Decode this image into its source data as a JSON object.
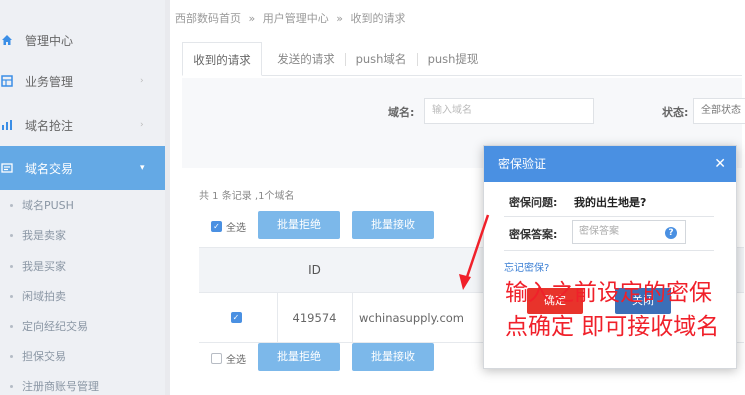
{
  "breadcrumb": [
    "西部数码首页",
    "»",
    "用户管理中心",
    "»",
    "收到的请求"
  ],
  "sidebar": {
    "items": [
      {
        "label": "管理中心",
        "icon": "home-icon",
        "arrow": ""
      },
      {
        "label": "业务管理",
        "icon": "grid-icon",
        "arrow": "›"
      },
      {
        "label": "域名抢注",
        "icon": "bar-chart-icon",
        "arrow": "›"
      },
      {
        "label": "域名交易",
        "icon": "trade-icon",
        "arrow": "▾"
      }
    ],
    "sub_items": [
      "域名PUSH",
      "我是卖家",
      "我是买家",
      "闲域拍卖",
      "定向经纪交易",
      "担保交易",
      "注册商账号管理"
    ]
  },
  "tabs": [
    "收到的请求",
    "发送的请求",
    "push域名",
    "push提现"
  ],
  "filters": {
    "domain_label": "域名:",
    "domain_placeholder": "输入域名",
    "status_label": "状态:",
    "status_value": "全部状态"
  },
  "list": {
    "count_text": "共 1 条记录 ,1个域名",
    "select_all": "全选",
    "batch_reject": "批量拒绝",
    "batch_accept": "批量接收",
    "columns": [
      "",
      "ID",
      ""
    ],
    "rows": [
      {
        "checked": true,
        "id": "419574",
        "domain": "wchinasupply.com"
      }
    ]
  },
  "modal": {
    "title": "密保验证",
    "close": "✕",
    "question_label": "密保问题:",
    "question_value": "我的出生地是?",
    "answer_label": "密保答案:",
    "answer_placeholder": "密保答案",
    "help": "?",
    "forgot": "忘记密保?",
    "confirm": "确定",
    "cancel": "关闭"
  },
  "annotation": {
    "line1": "输入之前设定的密保",
    "line2": "点确定 即可接收域名"
  },
  "colors": {
    "accent": "#4a90e2",
    "button": "#7cb8ea",
    "annotation": "#f0202a",
    "confirm": "#e8332b"
  }
}
